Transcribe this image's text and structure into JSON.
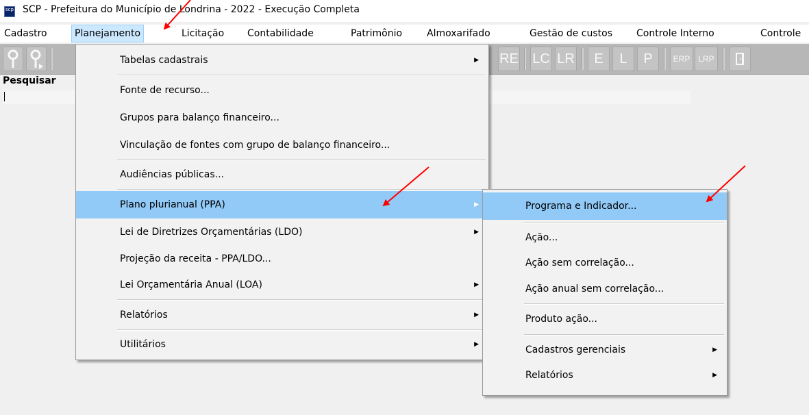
{
  "window": {
    "app_icon_text": "scp",
    "title": "SCP - Prefeitura do Município de Londrina - 2022 - Execução Completa"
  },
  "menubar": {
    "items": [
      {
        "label": "Cadastro"
      },
      {
        "label": "Planejamento"
      },
      {
        "label": "Licitação"
      },
      {
        "label": "Contabilidade"
      },
      {
        "label": "Patrimônio"
      },
      {
        "label": "Almoxarifado"
      },
      {
        "label": "Gestão de custos"
      },
      {
        "label": "Controle Interno"
      },
      {
        "label": "Controle"
      }
    ],
    "active": "Planejamento"
  },
  "toolbar": {
    "buttons": [
      {
        "icon": "key-icon"
      },
      {
        "icon": "key-arrow-icon"
      },
      {
        "label": "RE"
      },
      {
        "label": "LC"
      },
      {
        "label": "LR"
      },
      {
        "label": "E"
      },
      {
        "label": "L"
      },
      {
        "label": "P"
      },
      {
        "label": "ERP"
      },
      {
        "label": "LRP"
      },
      {
        "icon": "exit-door-icon"
      }
    ]
  },
  "search": {
    "label": "Pesquisar",
    "value": ""
  },
  "planejamento_menu": {
    "items": [
      {
        "label": "Tabelas cadastrais",
        "submenu": true
      },
      {
        "label": "Fonte de recurso...",
        "submenu": false
      },
      {
        "label": "Grupos para balanço financeiro...",
        "submenu": false
      },
      {
        "label": "Vinculação de fontes com grupo de balanço financeiro...",
        "submenu": false
      },
      {
        "label": "Audiências públicas...",
        "submenu": false
      },
      {
        "label": "Plano plurianual (PPA)",
        "submenu": true,
        "highlighted": true
      },
      {
        "label": "Lei de Diretrizes Orçamentárias (LDO)",
        "submenu": true
      },
      {
        "label": "Projeção da receita - PPA/LDO...",
        "submenu": false
      },
      {
        "label": "Lei Orçamentária Anual (LOA)",
        "submenu": true
      },
      {
        "label": "Relatórios",
        "submenu": true
      },
      {
        "label": "Utilitários",
        "submenu": true
      }
    ]
  },
  "ppa_submenu": {
    "items": [
      {
        "label": "Programa e Indicador...",
        "submenu": false,
        "highlighted": true
      },
      {
        "label": "Ação...",
        "submenu": false
      },
      {
        "label": "Ação sem correlação...",
        "submenu": false
      },
      {
        "label": "Ação anual sem correlação...",
        "submenu": false
      },
      {
        "label": "Produto ação...",
        "submenu": false
      },
      {
        "label": "Cadastros gerenciais",
        "submenu": true
      },
      {
        "label": "Relatórios",
        "submenu": true
      }
    ]
  },
  "colors": {
    "highlight": "#91c9f7",
    "menubar_active": "#cce8ff",
    "annotation_arrow": "#ff0000",
    "toolbar_bg": "#b7b7b7"
  }
}
